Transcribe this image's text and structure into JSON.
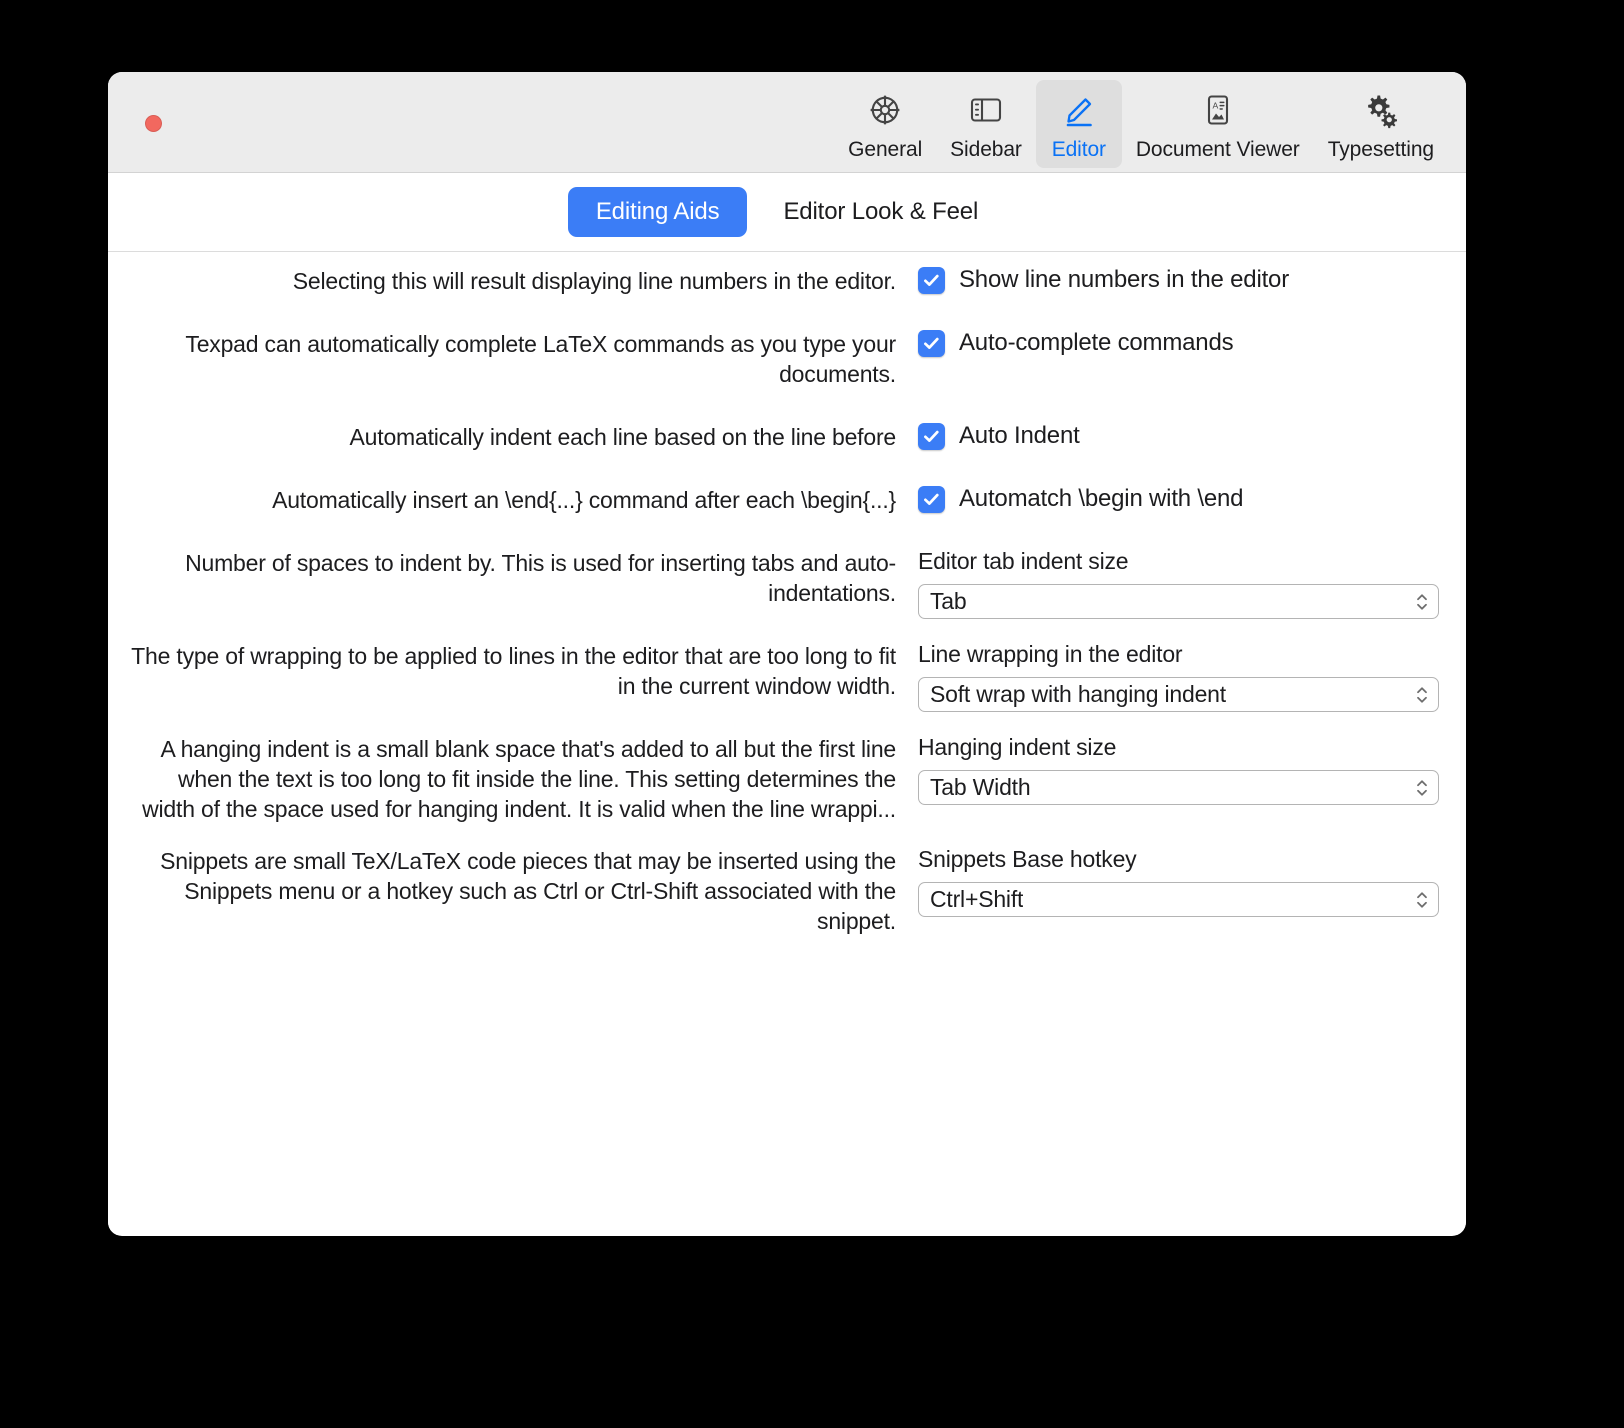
{
  "window": {
    "traffic_light": "close-button"
  },
  "toolbar": {
    "items": [
      {
        "label": "General",
        "icon": "gear-icon",
        "selected": false
      },
      {
        "label": "Sidebar",
        "icon": "sidebar-icon",
        "selected": false
      },
      {
        "label": "Editor",
        "icon": "pencil-icon",
        "selected": true
      },
      {
        "label": "Document Viewer",
        "icon": "document-viewer-icon",
        "selected": false
      },
      {
        "label": "Typesetting",
        "icon": "gears-icon",
        "selected": false
      }
    ]
  },
  "tabs": [
    {
      "label": "Editing Aids",
      "active": true
    },
    {
      "label": "Editor Look & Feel",
      "active": false
    }
  ],
  "checkbox_rows": [
    {
      "description": "Selecting this will result displaying line numbers in the editor.",
      "label": "Show line numbers in the editor",
      "checked": true
    },
    {
      "description": "Texpad can automatically complete LaTeX commands as you type your documents.",
      "label": "Auto-complete commands",
      "checked": true
    },
    {
      "description": "Automatically indent each line based on the line before",
      "label": "Auto Indent",
      "checked": true
    },
    {
      "description": "Automatically insert an \\end{...} command after each \\begin{...}",
      "label": "Automatch \\begin with \\end",
      "checked": true
    }
  ],
  "select_rows": [
    {
      "description": "Number of spaces to indent by. This is used for inserting tabs and auto-indentations.",
      "label": "Editor tab indent size",
      "value": "Tab"
    },
    {
      "description": "The type of wrapping to be applied to lines in the editor that are too long to fit in the current window width.",
      "label": "Line wrapping in the editor",
      "value": "Soft wrap with hanging indent"
    },
    {
      "description": "A hanging indent is a small blank space that's added to all but the first line when the text is too long to fit inside the line. This setting determines the width of the space used for hanging indent. It is valid when the line wrappi...",
      "label": "Hanging indent size",
      "value": "Tab Width"
    },
    {
      "description": "Snippets are small TeX/LaTeX code pieces that may be inserted using the Snippets menu or a hotkey such as Ctrl or Ctrl-Shift associated with the snippet.",
      "label": "Snippets Base hotkey",
      "value": "Ctrl+Shift"
    }
  ],
  "colors": {
    "accent": "#3b7df6",
    "toolbar_bg": "#ececec",
    "selected_tab_bg": "#dedede",
    "close_button": "#f2685f"
  }
}
